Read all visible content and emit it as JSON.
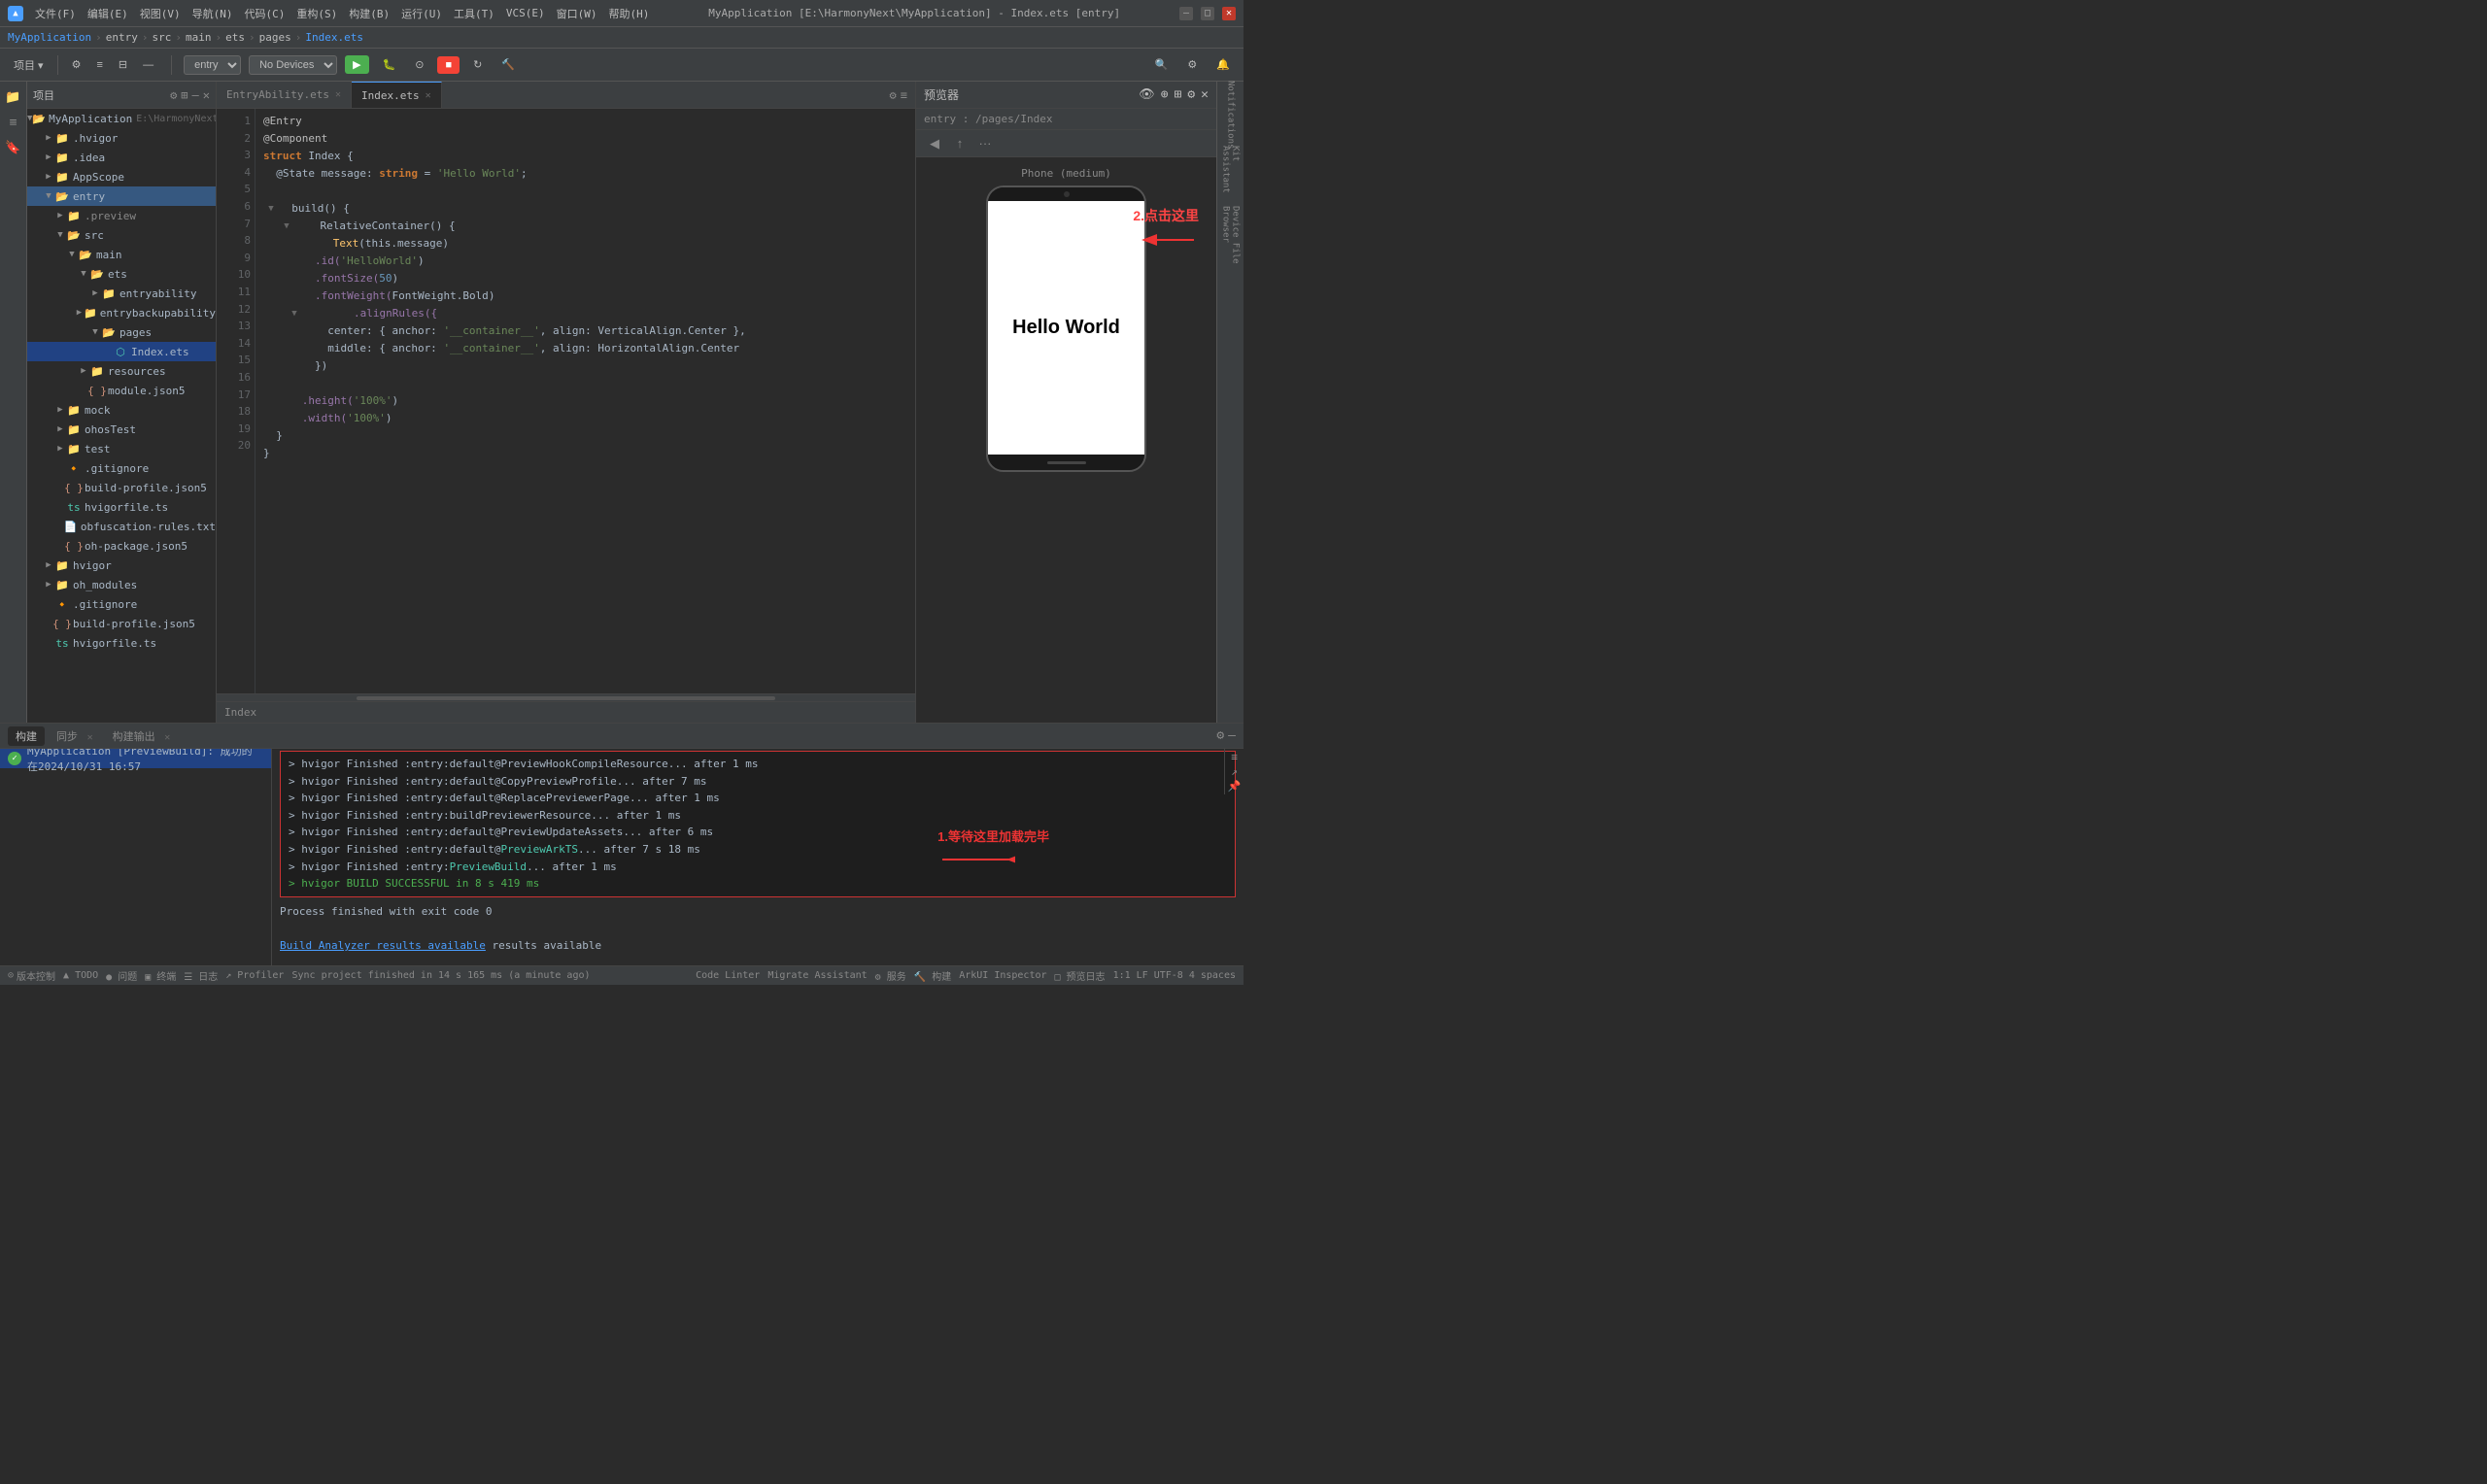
{
  "app": {
    "title": "MyApplication [E:\\HarmonyNext\\MyApplication] - Index.ets [entry]",
    "logo": "▲"
  },
  "titlebar": {
    "menus": [
      "文件(F)",
      "编辑(E)",
      "视图(V)",
      "导航(N)",
      "代码(C)",
      "重构(S)",
      "构建(B)",
      "运行(U)",
      "工具(T)",
      "VCS(E)",
      "窗口(W)",
      "帮助(H)"
    ],
    "minimize": "—",
    "maximize": "□",
    "close": "✕"
  },
  "breadcrumb": {
    "items": [
      "MyApplication",
      "entry",
      "src",
      "main",
      "ets",
      "pages",
      "Index.ets"
    ]
  },
  "toolbar": {
    "project_label": "项目 ▾",
    "entry_select": "entry",
    "device_select": "No Devices",
    "run_btn": "▶",
    "stop_btn": "■",
    "build_btn": "🔨",
    "reload_btn": "↻",
    "search_btn": "🔍"
  },
  "file_tree": {
    "header": "项目",
    "items": [
      {
        "id": "myapp",
        "label": "MyApplication",
        "path": "E:\\HarmonyNext\\MyApplication",
        "indent": 0,
        "type": "root",
        "expanded": true
      },
      {
        "id": "hvigor",
        "label": ".hvigor",
        "indent": 1,
        "type": "folder",
        "expanded": false
      },
      {
        "id": "idea",
        "label": ".idea",
        "indent": 1,
        "type": "folder",
        "expanded": false
      },
      {
        "id": "appscope",
        "label": "AppScope",
        "indent": 1,
        "type": "folder",
        "expanded": false
      },
      {
        "id": "entry",
        "label": "entry",
        "indent": 1,
        "type": "folder",
        "expanded": true,
        "selected": true
      },
      {
        "id": "preview",
        "label": ".preview",
        "indent": 2,
        "type": "folder",
        "expanded": false
      },
      {
        "id": "src",
        "label": "src",
        "indent": 2,
        "type": "folder",
        "expanded": true
      },
      {
        "id": "main",
        "label": "main",
        "indent": 3,
        "type": "folder",
        "expanded": true
      },
      {
        "id": "ets",
        "label": "ets",
        "indent": 4,
        "type": "folder",
        "expanded": true
      },
      {
        "id": "entryability",
        "label": "entryability",
        "indent": 5,
        "type": "folder",
        "expanded": false
      },
      {
        "id": "entrybackupability",
        "label": "entrybackupability",
        "indent": 5,
        "type": "folder",
        "expanded": false
      },
      {
        "id": "pages",
        "label": "pages",
        "indent": 5,
        "type": "folder",
        "expanded": true
      },
      {
        "id": "indexets",
        "label": "Index.ets",
        "indent": 6,
        "type": "ets",
        "active": true
      },
      {
        "id": "resources",
        "label": "resources",
        "indent": 4,
        "type": "folder",
        "expanded": false
      },
      {
        "id": "modulejson5",
        "label": "module.json5",
        "indent": 4,
        "type": "json"
      },
      {
        "id": "mock",
        "label": "mock",
        "indent": 2,
        "type": "folder",
        "expanded": false
      },
      {
        "id": "ohostest",
        "label": "ohosTest",
        "indent": 2,
        "type": "folder",
        "expanded": false
      },
      {
        "id": "test",
        "label": "test",
        "indent": 2,
        "type": "folder",
        "expanded": false
      },
      {
        "id": "gitignore",
        "label": ".gitignore",
        "indent": 2,
        "type": "file"
      },
      {
        "id": "buildprofile",
        "label": "build-profile.json5",
        "indent": 2,
        "type": "json"
      },
      {
        "id": "hvigorfile",
        "label": "hvigorfile.ts",
        "indent": 2,
        "type": "ts"
      },
      {
        "id": "obfuscation",
        "label": "obfuscation-rules.txt",
        "indent": 2,
        "type": "file"
      },
      {
        "id": "ohpackage",
        "label": "oh-package.json5",
        "indent": 2,
        "type": "json"
      },
      {
        "id": "hvigor2",
        "label": "hvigor",
        "indent": 1,
        "type": "folder",
        "expanded": false
      },
      {
        "id": "ohmodules",
        "label": "oh_modules",
        "indent": 1,
        "type": "folder",
        "expanded": false
      },
      {
        "id": "gitignore2",
        "label": ".gitignore",
        "indent": 1,
        "type": "file"
      },
      {
        "id": "buildprofile2",
        "label": "build-profile.json5",
        "indent": 1,
        "type": "json"
      },
      {
        "id": "hvigorfile2",
        "label": "hvigorfile.ts",
        "indent": 1,
        "type": "ts"
      }
    ]
  },
  "editor": {
    "tabs": [
      {
        "label": "EntryAbility.ets",
        "active": false
      },
      {
        "label": "Index.ets",
        "active": true
      }
    ],
    "lines": [
      {
        "num": 1,
        "tokens": [
          {
            "t": "@Entry",
            "cls": "ann"
          }
        ]
      },
      {
        "num": 2,
        "tokens": [
          {
            "t": "@Component",
            "cls": "ann"
          }
        ]
      },
      {
        "num": 3,
        "tokens": [
          {
            "t": "struct ",
            "cls": "kw"
          },
          {
            "t": "Index ",
            "cls": "id"
          },
          {
            "t": "{",
            "cls": "paren"
          }
        ]
      },
      {
        "num": 4,
        "tokens": [
          {
            "t": "  @State message: ",
            "cls": "id"
          },
          {
            "t": "string",
            "cls": "kw"
          },
          {
            "t": " = ",
            "cls": "id"
          },
          {
            "t": "'Hello World'",
            "cls": "str"
          },
          {
            "t": ";",
            "cls": "id"
          }
        ]
      },
      {
        "num": 5,
        "tokens": []
      },
      {
        "num": 6,
        "tokens": [
          {
            "t": "  build() {",
            "cls": "id"
          }
        ],
        "fold": true
      },
      {
        "num": 7,
        "tokens": [
          {
            "t": "    RelativeContainer() {",
            "cls": "id"
          }
        ],
        "fold": true
      },
      {
        "num": 8,
        "tokens": [
          {
            "t": "      Text(",
            "cls": "fn"
          },
          {
            "t": "this.message",
            "cls": "id"
          },
          {
            "t": ")",
            "cls": "paren"
          }
        ]
      },
      {
        "num": 9,
        "tokens": [
          {
            "t": "        .id(",
            "cls": "prop"
          },
          {
            "t": "'HelloWorld'",
            "cls": "str"
          },
          {
            "t": ")",
            "cls": "id"
          }
        ]
      },
      {
        "num": 10,
        "tokens": [
          {
            "t": "        .fontSize(",
            "cls": "prop"
          },
          {
            "t": "50",
            "cls": "num"
          },
          {
            "t": ")",
            "cls": "id"
          }
        ]
      },
      {
        "num": 11,
        "tokens": [
          {
            "t": "        .fontWeight(",
            "cls": "prop"
          },
          {
            "t": "FontWeight.Bold",
            "cls": "id"
          },
          {
            "t": ")",
            "cls": "id"
          }
        ]
      },
      {
        "num": 12,
        "tokens": [
          {
            "t": "        .alignRules({",
            "cls": "prop"
          }
        ],
        "fold": true
      },
      {
        "num": 13,
        "tokens": [
          {
            "t": "          center: { anchor: ",
            "cls": "id"
          },
          {
            "t": "'__container__'",
            "cls": "str"
          },
          {
            "t": ", align: VerticalAlign.Center },",
            "cls": "id"
          }
        ]
      },
      {
        "num": 14,
        "tokens": [
          {
            "t": "          middle: { anchor: ",
            "cls": "id"
          },
          {
            "t": "'__container__'",
            "cls": "str"
          },
          {
            "t": ", align: HorizontalAlign.Center",
            "cls": "id"
          }
        ]
      },
      {
        "num": 15,
        "tokens": [
          {
            "t": "        })",
            "cls": "id"
          }
        ]
      },
      {
        "num": 16,
        "tokens": []
      },
      {
        "num": 17,
        "tokens": [
          {
            "t": "      .height(",
            "cls": "prop"
          },
          {
            "t": "'100%'",
            "cls": "str"
          },
          {
            "t": ")",
            "cls": "id"
          }
        ]
      },
      {
        "num": 18,
        "tokens": [
          {
            "t": "      .width(",
            "cls": "prop"
          },
          {
            "t": "'100%'",
            "cls": "str"
          },
          {
            "t": ")",
            "cls": "id"
          }
        ]
      },
      {
        "num": 19,
        "tokens": [
          {
            "t": "  }",
            "cls": "id"
          }
        ]
      },
      {
        "num": 20,
        "tokens": [
          {
            "t": "}",
            "cls": "id"
          }
        ]
      }
    ],
    "tab_name": "Index"
  },
  "preview": {
    "title": "预览器",
    "route": "entry : /pages/Index",
    "device_label": "Phone (medium)",
    "hello_world": "Hello World",
    "annotation1": "2.点击这里",
    "annotation2_line1": "1.等待这里加载完毕"
  },
  "bottom_panel": {
    "tabs": [
      "构建",
      "同步",
      "构建输出"
    ],
    "build_items": [
      {
        "label": "MyApplication [PreviewBuild]: 成功的 在2024/10/31 16:57",
        "selected": true
      }
    ],
    "console_lines": [
      "> hvigor Finished :entry:default@PreviewHookCompileResource... after 1 ms",
      "> hvigor Finished :entry:default@CopyPreviewProfile... after 7 ms",
      "> hvigor Finished :entry:default@ReplacePreviewerPage... after 1 ms",
      "> hvigor Finished :entry:buildPreviewerResource... after 1 ms",
      "> hvigor Finished :entry:default@PreviewUpdateAssets... after 6 ms",
      "> hvigor Finished :entry:default@PreviewArkTS... after 7 s 18 ms",
      "> hvigor Finished :entry:PreviewBuild... after 1 ms",
      "> hvigor BUILD SUCCESSFUL in 8 s 419 ms"
    ],
    "after_console": [
      "Process finished with exit code 0",
      "",
      "Build Analyzer results available"
    ]
  },
  "status_bar": {
    "vcs": "版本控制",
    "todo": "▲ TODO",
    "problems": "● 问题",
    "terminal": "▣ 终端",
    "log": "☰ 日志",
    "profiler": "↗ Profiler",
    "code_linter": "Code Linter",
    "migrate": "Migrate Assistant",
    "services": "⚙ 服务",
    "build": "🔨 构建",
    "arkui": "ArkUI Inspector",
    "preview_log": "□ 预览日志",
    "right": "1:1  LF  UTF-8  4 spaces",
    "sync_msg": "Sync project finished in 14 s 165 ms (a minute ago)"
  }
}
